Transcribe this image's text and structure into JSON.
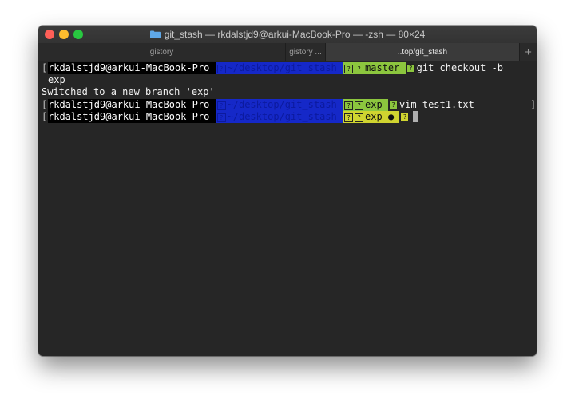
{
  "window": {
    "title": "git_stash — rkdalstjd9@arkui-MacBook-Pro — -zsh — 80×24"
  },
  "tabs": [
    {
      "label": "gistory",
      "active": false
    },
    {
      "label": "gistory ...",
      "active": false
    },
    {
      "label": "..top/git_stash",
      "active": true
    }
  ],
  "tab_add_label": "+",
  "terminal": {
    "lines": [
      {
        "bracket_open": "[",
        "user": "rkdalstjd9@arkui-MacBook-Pro ",
        "path": "~/desktop/git_stash",
        "branch": "master",
        "command": "git checkout -b",
        "bracket_close": ""
      },
      {
        "text": "exp"
      },
      {
        "text": "Switched to a new branch 'exp'"
      },
      {
        "bracket_open": "[",
        "user": "rkdalstjd9@arkui-MacBook-Pro ",
        "path": "~/desktop/git_stash",
        "branch": "exp",
        "command": "vim test1.txt",
        "bracket_close": "]"
      },
      {
        "bracket_open": "[",
        "user": "rkdalstjd9@arkui-MacBook-Pro ",
        "path": "~/desktop/git_stash",
        "branch": "exp",
        "dirty": "●",
        "command": "",
        "bracket_close": ""
      }
    ],
    "glyph": "?"
  },
  "colors": {
    "path_bg": "#1528c8",
    "git_clean_bg": "#8cc63e",
    "git_dirty_bg": "#d0d430",
    "terminal_bg": "#262626"
  }
}
